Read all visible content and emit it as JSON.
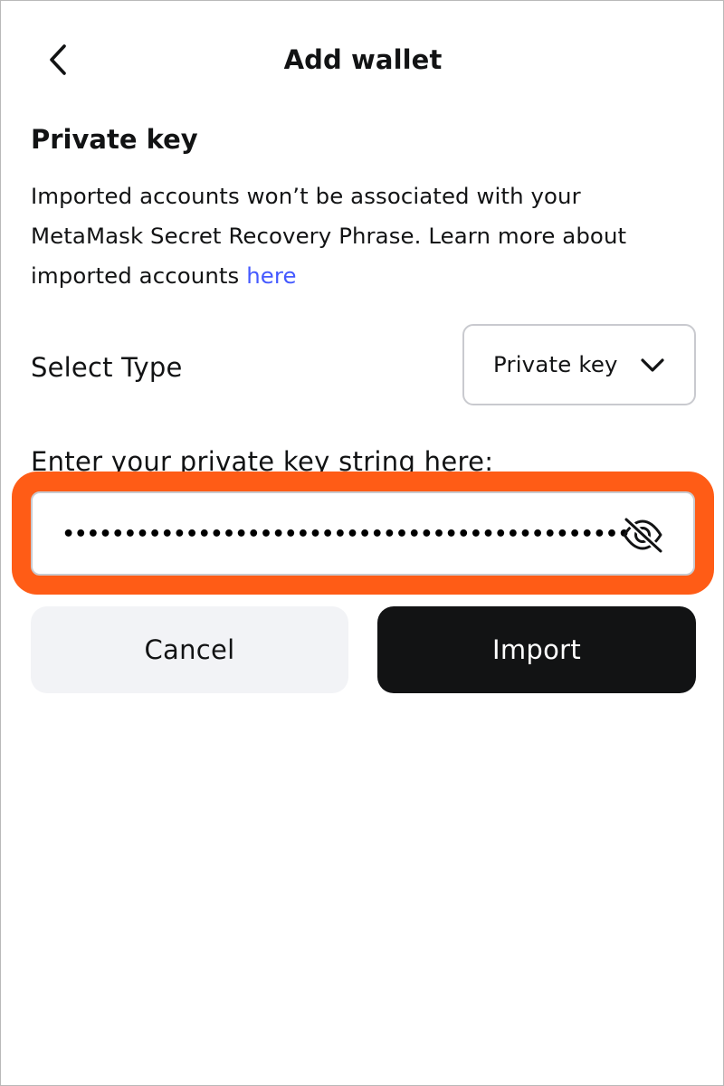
{
  "header": {
    "title": "Add wallet",
    "back_icon": "chevron-left-icon"
  },
  "section": {
    "title": "Private key",
    "description": "Imported accounts won’t be associated with your MetaMask Secret Recovery Phrase. Learn more about imported accounts ",
    "link_text": "here",
    "link_color": "#4459ff"
  },
  "select_type": {
    "label": "Select Type",
    "value": "Private key",
    "icon": "chevron-down-icon"
  },
  "key_field": {
    "label": "Enter your private key string here:",
    "masked_value": "•••••••••••••••••••••••••••••••••••••••••••••••••••••…",
    "toggle_icon": "eye-slash-icon",
    "highlight_color": "#ff5c16"
  },
  "actions": {
    "cancel_label": "Cancel",
    "import_label": "Import"
  }
}
